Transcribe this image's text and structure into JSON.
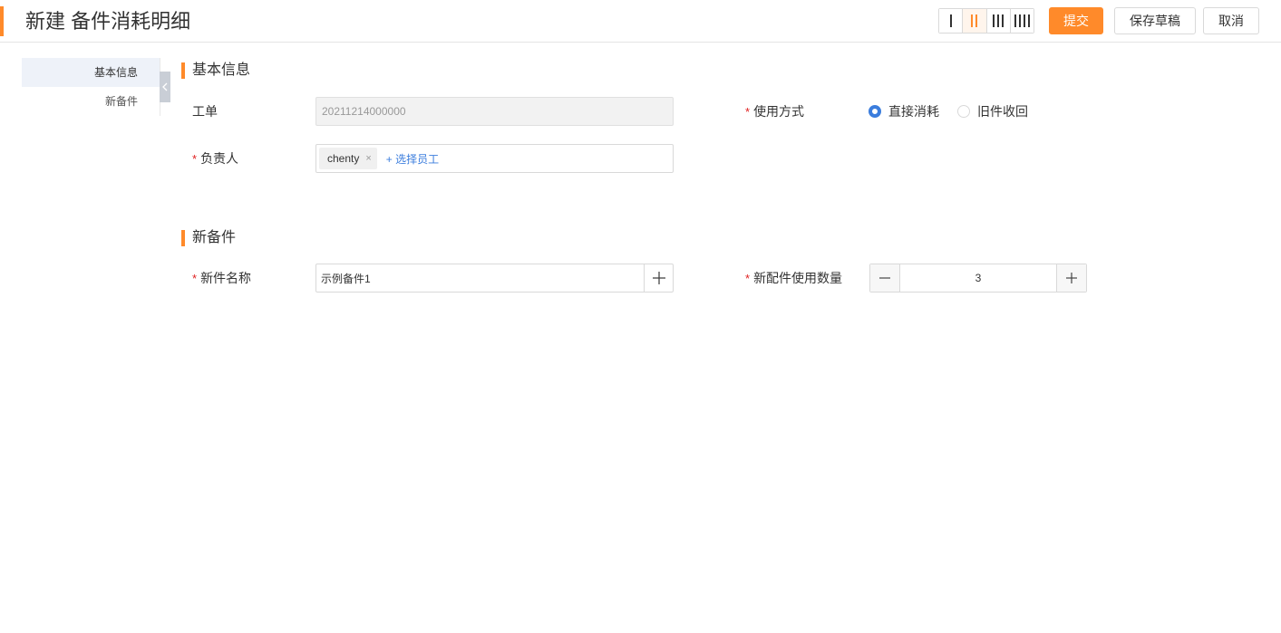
{
  "header": {
    "title": "新建 备件消耗明细",
    "layout_options": [
      "1-column",
      "2-column",
      "3-column",
      "4-column"
    ],
    "active_layout": "2-column",
    "submit_label": "提交",
    "draft_label": "保存草稿",
    "cancel_label": "取消"
  },
  "sidebar": {
    "items": [
      {
        "label": "基本信息",
        "active": true
      },
      {
        "label": "新备件",
        "active": false
      }
    ]
  },
  "basic_info": {
    "section_title": "基本信息",
    "work_order_label": "工单",
    "work_order_value": "20211214000000",
    "usage_label": "使用方式",
    "usage_options": [
      "直接消耗",
      "旧件收回"
    ],
    "usage_selected": "直接消耗",
    "owner_label": "负责人",
    "owner_tag": "chenty",
    "owner_remove": "×",
    "add_staff_label": "+ 选择员工"
  },
  "new_parts": {
    "section_title": "新备件",
    "name_label": "新件名称",
    "name_value": "示例备件1",
    "qty_label": "新配件使用数量",
    "qty_value": "3"
  },
  "colors": {
    "accent": "#ff8a2a",
    "link": "#3b7ddd",
    "required": "#e02020"
  },
  "icons": {
    "collapse": "chevron-left-icon",
    "add": "plus-icon",
    "minus": "minus-icon",
    "close": "close-icon"
  }
}
